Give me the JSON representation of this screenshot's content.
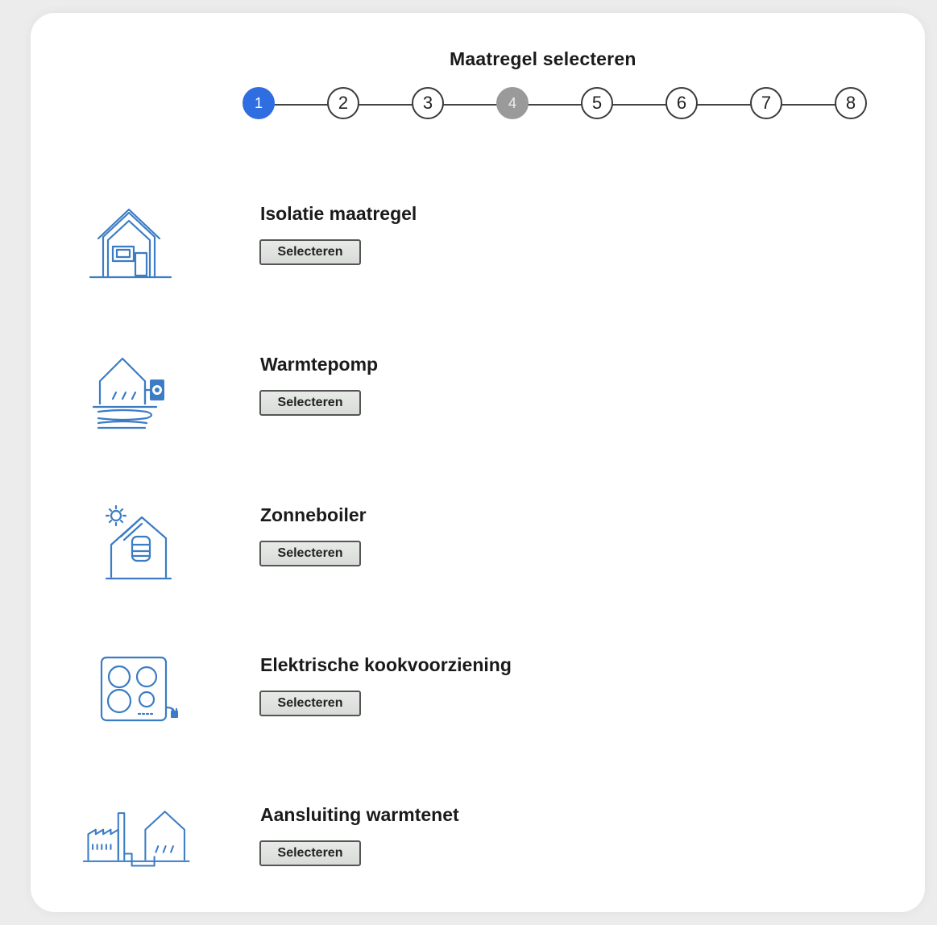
{
  "page": {
    "title": "Maatregel selecteren"
  },
  "stepper": {
    "steps": [
      {
        "label": "1",
        "state": "active"
      },
      {
        "label": "2",
        "state": "default"
      },
      {
        "label": "3",
        "state": "default"
      },
      {
        "label": "4",
        "state": "disabled"
      },
      {
        "label": "5",
        "state": "default"
      },
      {
        "label": "6",
        "state": "default"
      },
      {
        "label": "7",
        "state": "default"
      },
      {
        "label": "8",
        "state": "default"
      }
    ]
  },
  "measures": [
    {
      "title": "Isolatie maatregel",
      "button_label": "Selecteren",
      "icon": "house-insulation-icon"
    },
    {
      "title": "Warmtepomp",
      "button_label": "Selecteren",
      "icon": "heat-pump-icon"
    },
    {
      "title": "Zonneboiler",
      "button_label": "Selecteren",
      "icon": "solar-boiler-icon"
    },
    {
      "title": "Elektrische kookvoorziening",
      "button_label": "Selecteren",
      "icon": "electric-cooktop-icon"
    },
    {
      "title": "Aansluiting warmtenet",
      "button_label": "Selecteren",
      "icon": "district-heating-icon"
    }
  ],
  "colors": {
    "accent": "#2f6ee0",
    "icon": "#3b7cc4",
    "disabled_step": "#9a9a9a",
    "background": "#ececec"
  }
}
